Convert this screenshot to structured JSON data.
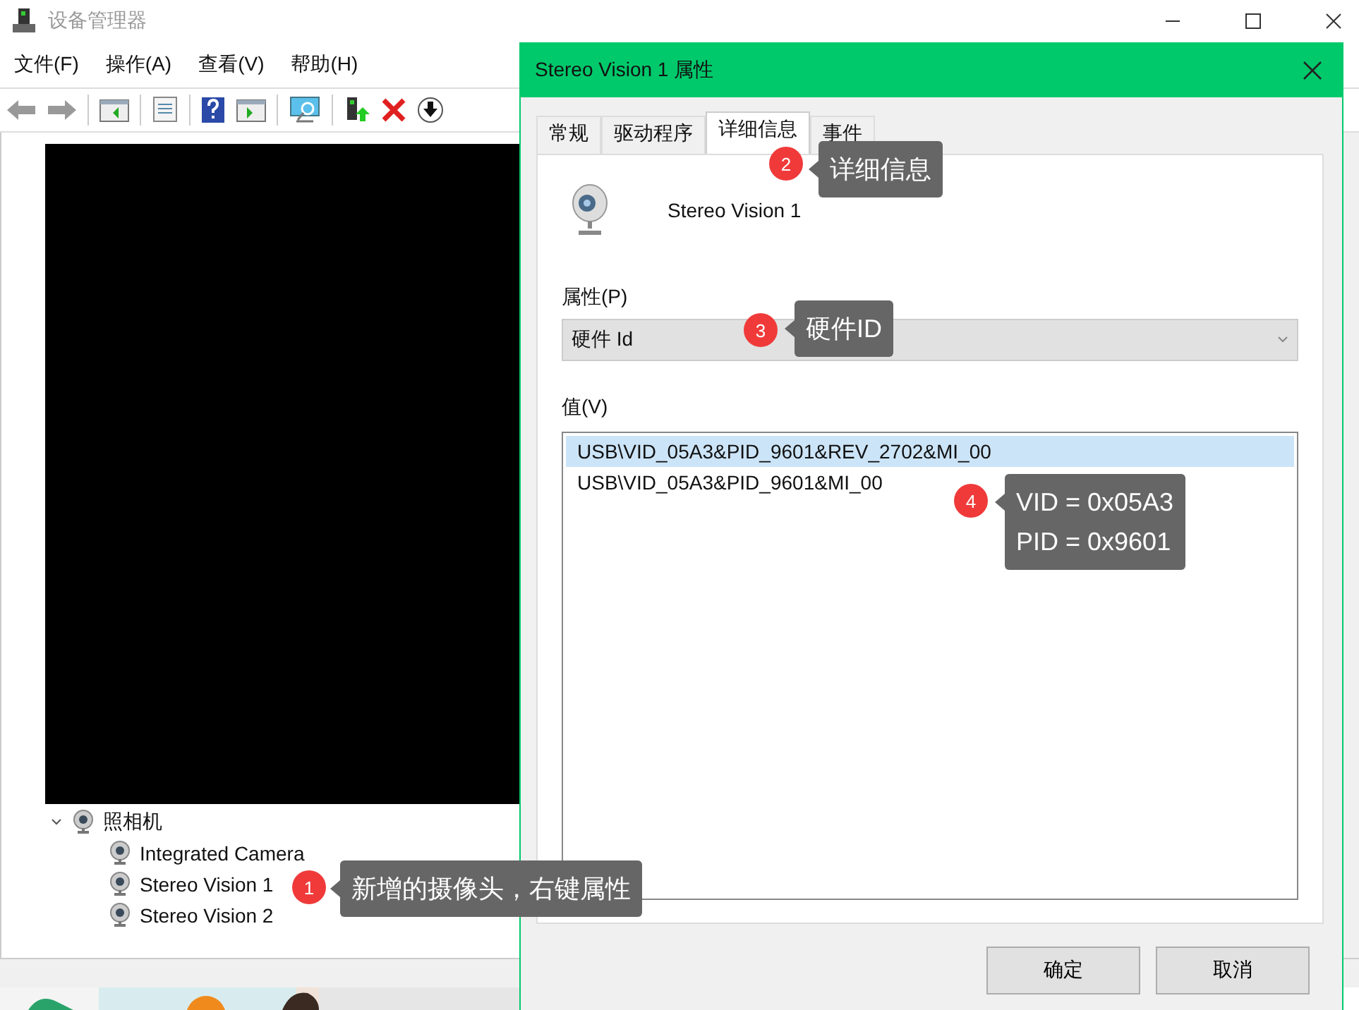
{
  "main_window": {
    "title": "设备管理器",
    "menu": [
      "文件(F)",
      "操作(A)",
      "查看(V)",
      "帮助(H)"
    ],
    "tree": {
      "label": "照相机",
      "expanded": true,
      "children": [
        {
          "label": "Integrated Camera"
        },
        {
          "label": "Stereo Vision 1"
        },
        {
          "label": "Stereo Vision 2"
        }
      ]
    }
  },
  "dialog": {
    "title": "Stereo Vision 1 属性",
    "tabs": [
      {
        "label": "常规",
        "selected": false
      },
      {
        "label": "驱动程序",
        "selected": false
      },
      {
        "label": "详细信息",
        "selected": true
      },
      {
        "label": "事件",
        "selected": false
      }
    ],
    "device_name": "Stereo Vision 1",
    "property_label": "属性(P)",
    "property_value": "硬件 Id",
    "value_label": "值(V)",
    "values": [
      {
        "text": "USB\\VID_05A3&PID_9601&REV_2702&MI_00",
        "selected": true
      },
      {
        "text": "USB\\VID_05A3&PID_9601&MI_00",
        "selected": false
      }
    ],
    "buttons": [
      "确定",
      "取消"
    ]
  },
  "annotations": [
    {
      "number": "1",
      "lines": [
        "新增的摄像头，右键属性"
      ]
    },
    {
      "number": "2",
      "lines": [
        "详细信息"
      ]
    },
    {
      "number": "3",
      "lines": [
        "硬件ID"
      ]
    },
    {
      "number": "4",
      "lines": [
        "VID = 0x05A3",
        "PID = 0x9601"
      ]
    }
  ]
}
